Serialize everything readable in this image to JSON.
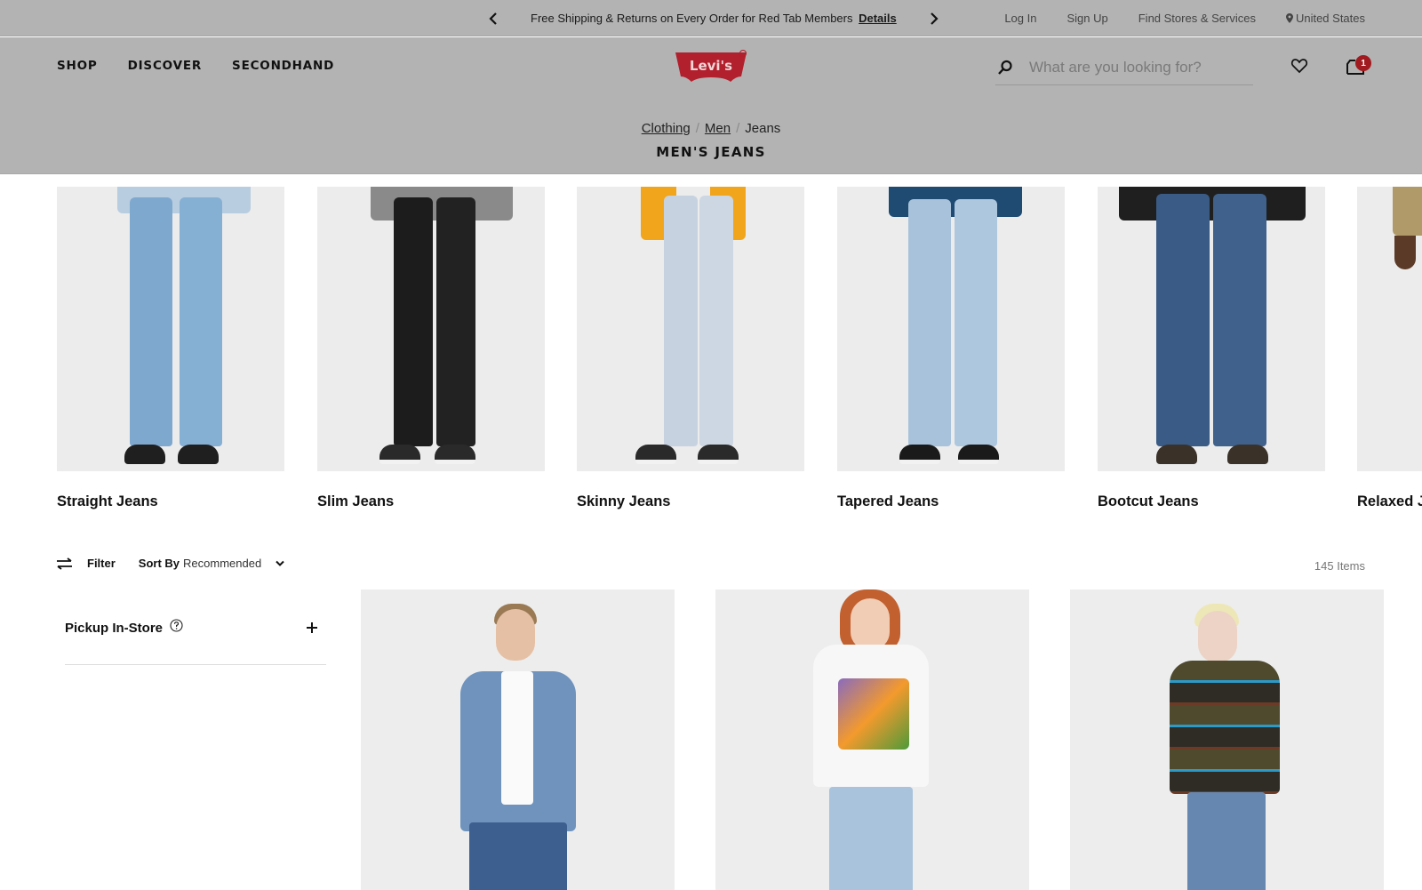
{
  "promo": {
    "text": "Free Shipping & Returns on Every Order for Red Tab Members",
    "link": "Details",
    "prev_icon": "chevron-left-icon",
    "next_icon": "chevron-right-icon"
  },
  "utility_links": {
    "login": "Log In",
    "signup": "Sign Up",
    "stores": "Find Stores & Services",
    "country": "United States",
    "country_icon": "location-pin-icon"
  },
  "nav": {
    "items": [
      "SHOP",
      "DISCOVER",
      "SECONDHAND"
    ]
  },
  "brand": {
    "logo_text": "Levi's",
    "logo_color": "#c41230"
  },
  "search": {
    "placeholder": "What are you looking for?",
    "value": ""
  },
  "cart": {
    "count": "1",
    "badge_color": "#a11a1f"
  },
  "breadcrumb": {
    "items": [
      "Clothing",
      "Men",
      "Jeans"
    ]
  },
  "page_title": "MEN'S JEANS",
  "categories": [
    {
      "label": "Straight Jeans"
    },
    {
      "label": "Slim Jeans"
    },
    {
      "label": "Skinny Jeans"
    },
    {
      "label": "Tapered Jeans"
    },
    {
      "label": "Bootcut Jeans"
    },
    {
      "label": "Relaxed Jeans"
    }
  ],
  "toolbar": {
    "filter_label": "Filter",
    "sort_label": "Sort By",
    "sort_value": "Recommended",
    "item_count": "145 Items"
  },
  "filters": {
    "pickup_label": "Pickup In-Store"
  },
  "products": [
    {
      "name": "Denim shirt with jeans",
      "top_color": "#6f93bd",
      "bottom_color": "#3d5f8f"
    },
    {
      "name": "Graphic tee with light jeans",
      "top_color": "#f7f7f7",
      "bottom_color": "#a9c3dc"
    },
    {
      "name": "Striped long sleeve with jeans",
      "top_color": "#4f4a2e",
      "bottom_color": "#6688b0"
    }
  ]
}
